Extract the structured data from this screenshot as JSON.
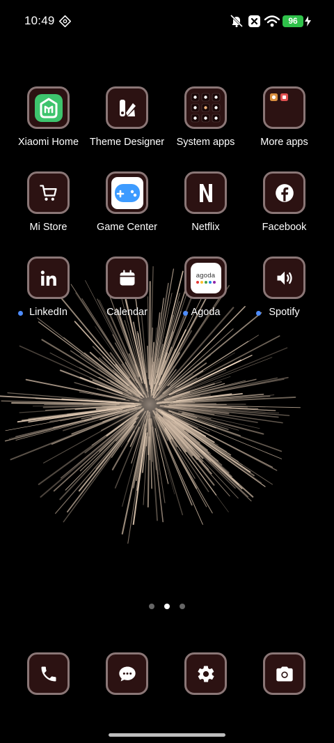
{
  "status_bar": {
    "time": "10:49",
    "battery_level": "96",
    "battery_color": "#2fc14a",
    "icons": [
      "settings-diamond-icon",
      "silent-bell-icon",
      "close-box-icon",
      "wifi-icon",
      "charging-bolt-icon"
    ]
  },
  "apps": [
    {
      "label": "Xiaomi Home",
      "icon": "xiaomi-home-icon",
      "new": false
    },
    {
      "label": "Theme Designer",
      "icon": "theme-designer-icon",
      "new": false
    },
    {
      "label": "System apps",
      "icon": "folder-icon",
      "new": false
    },
    {
      "label": "More apps",
      "icon": "folder-icon",
      "new": false
    },
    {
      "label": "Mi Store",
      "icon": "cart-icon",
      "new": false
    },
    {
      "label": "Game Center",
      "icon": "gamepad-icon",
      "new": false
    },
    {
      "label": "Netflix",
      "icon": "netflix-icon",
      "new": false
    },
    {
      "label": "Facebook",
      "icon": "facebook-icon",
      "new": false
    },
    {
      "label": "LinkedIn",
      "icon": "linkedin-icon",
      "new": true
    },
    {
      "label": "Calendar",
      "icon": "calendar-icon",
      "new": false
    },
    {
      "label": "Agoda",
      "icon": "agoda-icon",
      "new": true,
      "icon_text": "agoda"
    },
    {
      "label": "Spotify",
      "icon": "speaker-icon",
      "new": true
    }
  ],
  "pager": {
    "pages": 3,
    "current": 2
  },
  "dock": [
    {
      "icon": "phone-icon"
    },
    {
      "icon": "messages-icon"
    },
    {
      "icon": "settings-gear-icon"
    },
    {
      "icon": "camera-icon"
    }
  ],
  "colors": {
    "icon_background": "#2c1212",
    "icon_border": "#8a7676",
    "notification_dot": "#4d8cff",
    "xiaomi_home_green": "#3ec46d",
    "game_center_blue": "#3d9bff"
  }
}
